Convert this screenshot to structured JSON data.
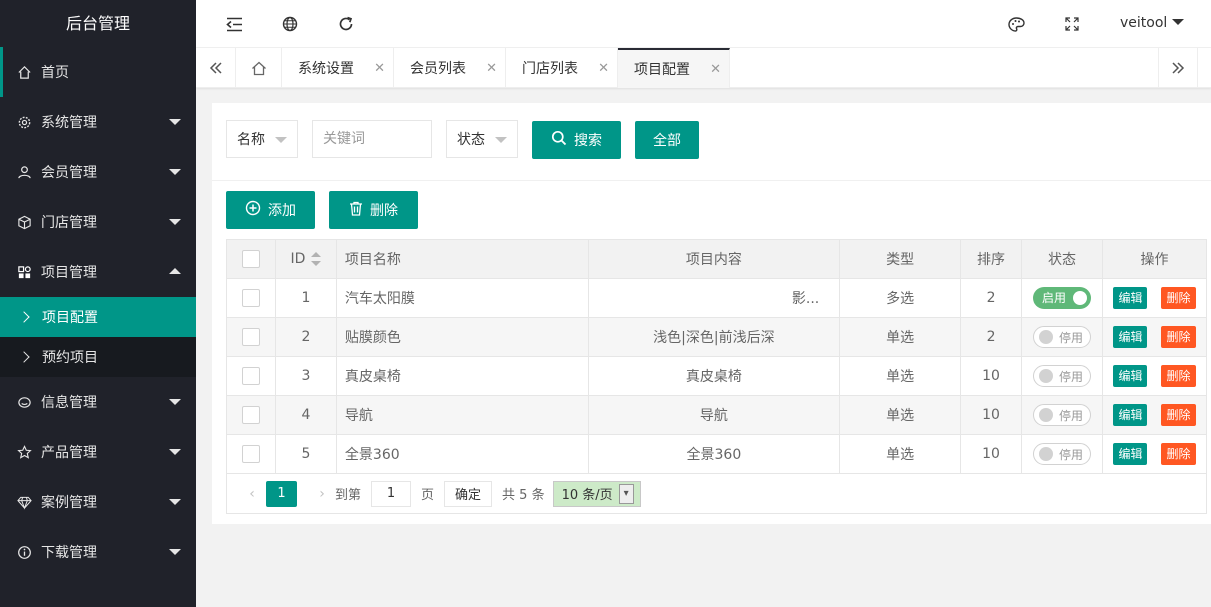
{
  "app": {
    "title": "后台管理"
  },
  "sidebar": {
    "items": [
      {
        "label": "首页",
        "icon": "home-icon"
      },
      {
        "label": "系统管理",
        "icon": "gear-icon"
      },
      {
        "label": "会员管理",
        "icon": "user-icon"
      },
      {
        "label": "门店管理",
        "icon": "cube-icon"
      },
      {
        "label": "项目管理",
        "icon": "apps-icon"
      },
      {
        "label": "信息管理",
        "icon": "chat-icon"
      },
      {
        "label": "产品管理",
        "icon": "star-icon"
      },
      {
        "label": "案例管理",
        "icon": "diamond-icon"
      },
      {
        "label": "下载管理",
        "icon": "info-icon"
      }
    ],
    "project_children": [
      {
        "label": "项目配置",
        "active": true
      },
      {
        "label": "预约项目",
        "active": false
      }
    ]
  },
  "header": {
    "user": "veitool"
  },
  "tabs": [
    {
      "label": "系统设置"
    },
    {
      "label": "会员列表"
    },
    {
      "label": "门店列表"
    },
    {
      "label": "项目配置",
      "active": true
    }
  ],
  "filter": {
    "name_select": "名称",
    "keyword_placeholder": "关键词",
    "status_select": "状态",
    "search_label": "搜索",
    "all_label": "全部"
  },
  "actions": {
    "add_label": "添加",
    "delete_label": "删除"
  },
  "table": {
    "columns": [
      "ID",
      "项目名称",
      "项目内容",
      "类型",
      "排序",
      "状态",
      "操作"
    ],
    "rows": [
      {
        "id": "1",
        "name": "汽车太阳膜",
        "content": "影...",
        "type": "多选",
        "order": "2",
        "status": "启用",
        "on": true
      },
      {
        "id": "2",
        "name": "贴膜颜色",
        "content": "浅色|深色|前浅后深",
        "type": "单选",
        "order": "2",
        "status": "停用",
        "on": false
      },
      {
        "id": "3",
        "name": "真皮桌椅",
        "content": "真皮桌椅",
        "type": "单选",
        "order": "10",
        "status": "停用",
        "on": false
      },
      {
        "id": "4",
        "name": "导航",
        "content": "导航",
        "type": "单选",
        "order": "10",
        "status": "停用",
        "on": false
      },
      {
        "id": "5",
        "name": "全景360",
        "content": "全景360",
        "type": "单选",
        "order": "10",
        "status": "停用",
        "on": false
      }
    ],
    "edit_label": "编辑",
    "del_label": "删除"
  },
  "pager": {
    "current": "1",
    "goto_label": "到第",
    "goto_value": "1",
    "page_unit": "页",
    "confirm_label": "确定",
    "total": "共 5 条",
    "size": "10 条/页"
  },
  "colors": {
    "primary": "#009688",
    "danger": "#ff5722",
    "switch_on": "#5fb878",
    "sidebar": "#20222a"
  }
}
